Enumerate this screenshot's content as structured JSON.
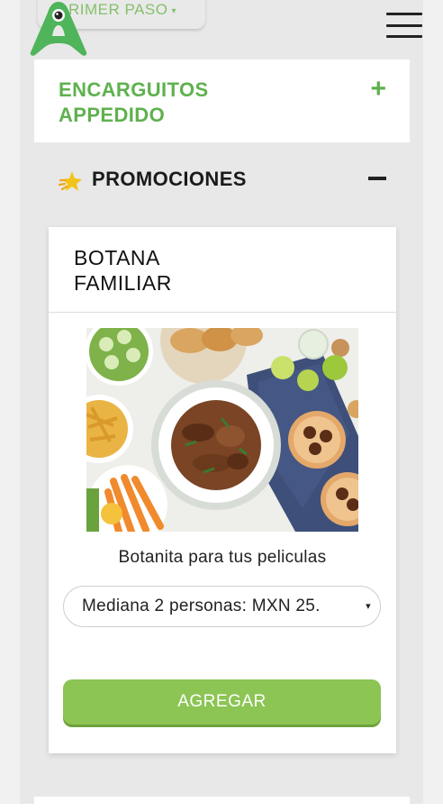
{
  "nav": {
    "step_label": "RIMER PASO",
    "step_caret": "▾",
    "menu_icon": "hamburger-icon",
    "logo_icon": "alien-a-logo"
  },
  "categories": [
    {
      "title": "ENCARGUITOS APPEDIDO",
      "toggle": "+",
      "expanded": false
    },
    {
      "title": "PROMOCIONES",
      "icon": "sparkle-star-icon",
      "toggle": "−",
      "expanded": true
    }
  ],
  "product": {
    "title": "BOTANA FAMILIAR",
    "image": "food-platter-photo",
    "description": "Botanita para tus peliculas",
    "size_selected": "Mediana 2 personas: MXN 25.",
    "select_arrow": "▾",
    "add_label": "AGREGAR"
  },
  "colors": {
    "brand_green": "#5fb14e",
    "button_green": "#8cc554",
    "step_text": "#86c06b"
  }
}
